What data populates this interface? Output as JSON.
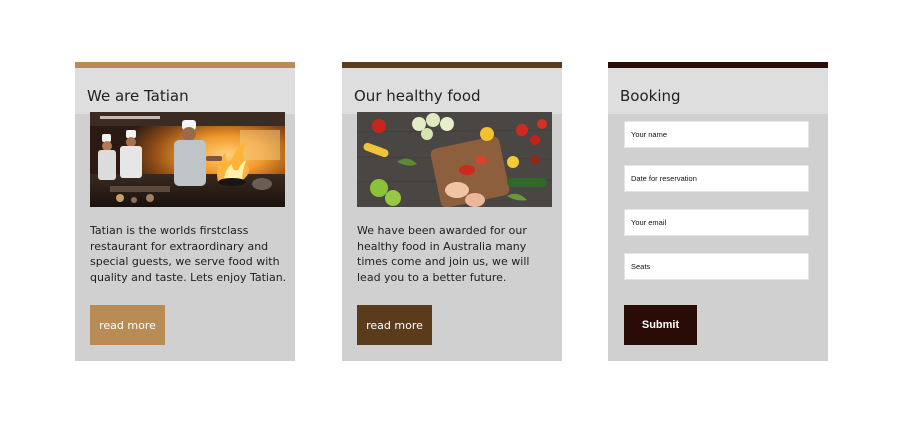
{
  "cards": [
    {
      "title": "We are Tatian",
      "bar_color": "#b98c56",
      "image": "kitchen-chefs-cooking-photo",
      "text": "Tatian is the worlds firstclass restaurant for extraordinary and special guests, we serve food with quality and taste. Lets enjoy Tatian.",
      "button_label": "read more",
      "button_color": "#b98c56"
    },
    {
      "title": "Our healthy food",
      "bar_color": "#5a3b1b",
      "image": "vegetables-chopping-board-photo",
      "text": "We have been awarded for our healthy food in Australia many times come and join us, we will lead you to a better future.",
      "button_label": "read more",
      "button_color": "#5a3b1b"
    }
  ],
  "booking": {
    "title": "Booking",
    "bar_color": "#2a0c06",
    "fields": [
      {
        "placeholder": "Your name"
      },
      {
        "placeholder": "Date for reservation"
      },
      {
        "placeholder": "Your email"
      },
      {
        "placeholder": "Seats"
      }
    ],
    "submit_label": "Submit",
    "submit_color": "#2a0c06"
  }
}
